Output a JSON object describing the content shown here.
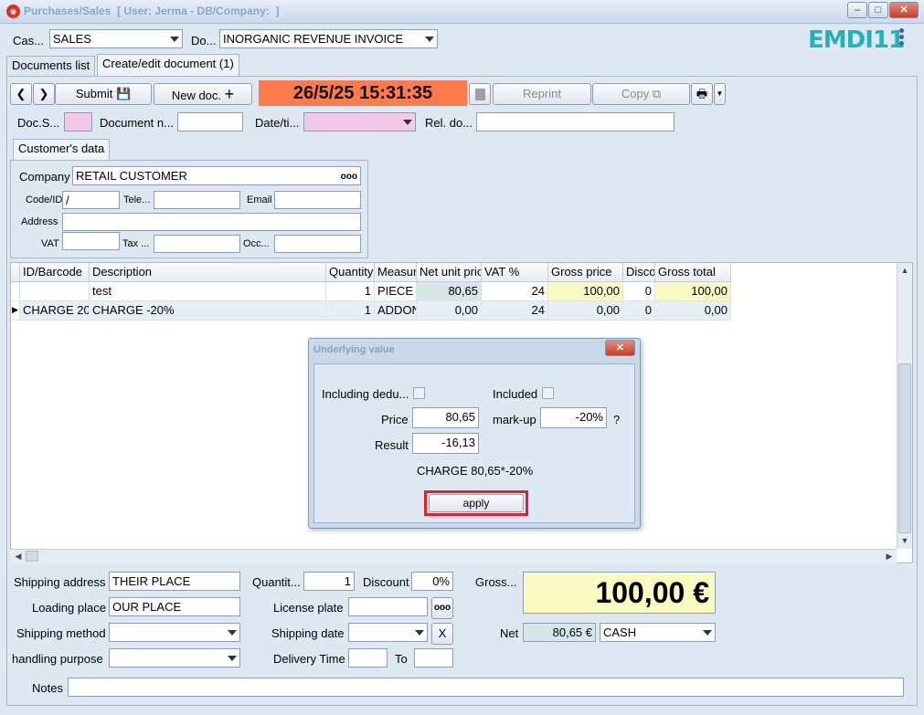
{
  "window": {
    "title": "Purchases/Sales  [ User: Jerma - DB/Company:  ]",
    "app_icon": "app-logo-icon",
    "minimize": "–",
    "maximize": "□",
    "close": "✕"
  },
  "header": {
    "cash_label": "Cas...",
    "cash_value": "SALES",
    "doc_label": "Do...",
    "doc_value": "INORGANIC REVENUE INVOICE",
    "logo": "EMDI11"
  },
  "tabs": [
    {
      "label": "Documents list"
    },
    {
      "label": "Create/edit document (1)"
    }
  ],
  "toolbar": {
    "submit_label": "Submit",
    "new_doc_label": "New doc.",
    "datetime": "26/5/25 15:31:35",
    "reprint_label": "Reprint",
    "copy_label": "Copy"
  },
  "docfields": {
    "doc_series_label": "Doc.S...",
    "doc_number_label": "Document n...",
    "date_label": "Date/ti...",
    "rel_doc_label": "Rel. do..."
  },
  "customer": {
    "tab_label": "Customer's data",
    "company_label": "Company",
    "company_value": "RETAIL CUSTOMER",
    "company_more": "ooo",
    "code_label": "Code/ID",
    "code_value": "/",
    "tel_label": "Tele...",
    "email_label": "Email",
    "address_label": "Address",
    "vat_label": "VAT",
    "tax_label": "Tax ...",
    "occ_label": "Occ..."
  },
  "grid": {
    "columns": [
      "ID/Barcode",
      "Description",
      "Quantity",
      "Measur",
      "Net unit pric",
      "VAT %",
      "Gross price",
      "Disco",
      "Gross total"
    ],
    "rows": [
      {
        "id": "",
        "description": "test",
        "quantity": "1",
        "measure": "PIECE",
        "net_unit": "80,65",
        "vat": "24",
        "gross_price": "100,00",
        "discount": "0",
        "gross_total": "100,00"
      },
      {
        "id": "CHARGE 20",
        "description": "CHARGE -20%",
        "quantity": "1",
        "measure": "ADDON",
        "net_unit": "0,00",
        "vat": "24",
        "gross_price": "0,00",
        "discount": "0",
        "gross_total": "0,00"
      }
    ]
  },
  "dialog": {
    "title": "Underlying value",
    "close": "✕",
    "including_label": "Including dedu...",
    "included_label": "Included",
    "price_label": "Price",
    "price_value": "80,65",
    "markup_label": "mark-up",
    "markup_value": "-20%",
    "help": "?",
    "result_label": "Result",
    "result_value": "-16,13",
    "formula": "CHARGE 80,65*-20%",
    "apply_label": "apply"
  },
  "footer": {
    "shipping_address_label": "Shipping address",
    "shipping_address_value": "THEIR PLACE",
    "loading_place_label": "Loading place",
    "loading_place_value": "OUR PLACE",
    "shipping_method_label": "Shipping method",
    "handling_purpose_label": "handling purpose",
    "quantity_label": "Quantit...",
    "quantity_value": "1",
    "discount_label": "Discount",
    "discount_value": "0%",
    "license_plate_label": "License plate",
    "license_more": "ooo",
    "shipping_date_label": "Shipping date",
    "clear_date": "X",
    "delivery_time_label": "Delivery Time",
    "to_label": "To",
    "gross_label": "Gross...",
    "gross_value": "100,00 €",
    "net_label": "Net",
    "net_value": "80,65 €",
    "payment_value": "CASH",
    "notes_label": "Notes"
  }
}
